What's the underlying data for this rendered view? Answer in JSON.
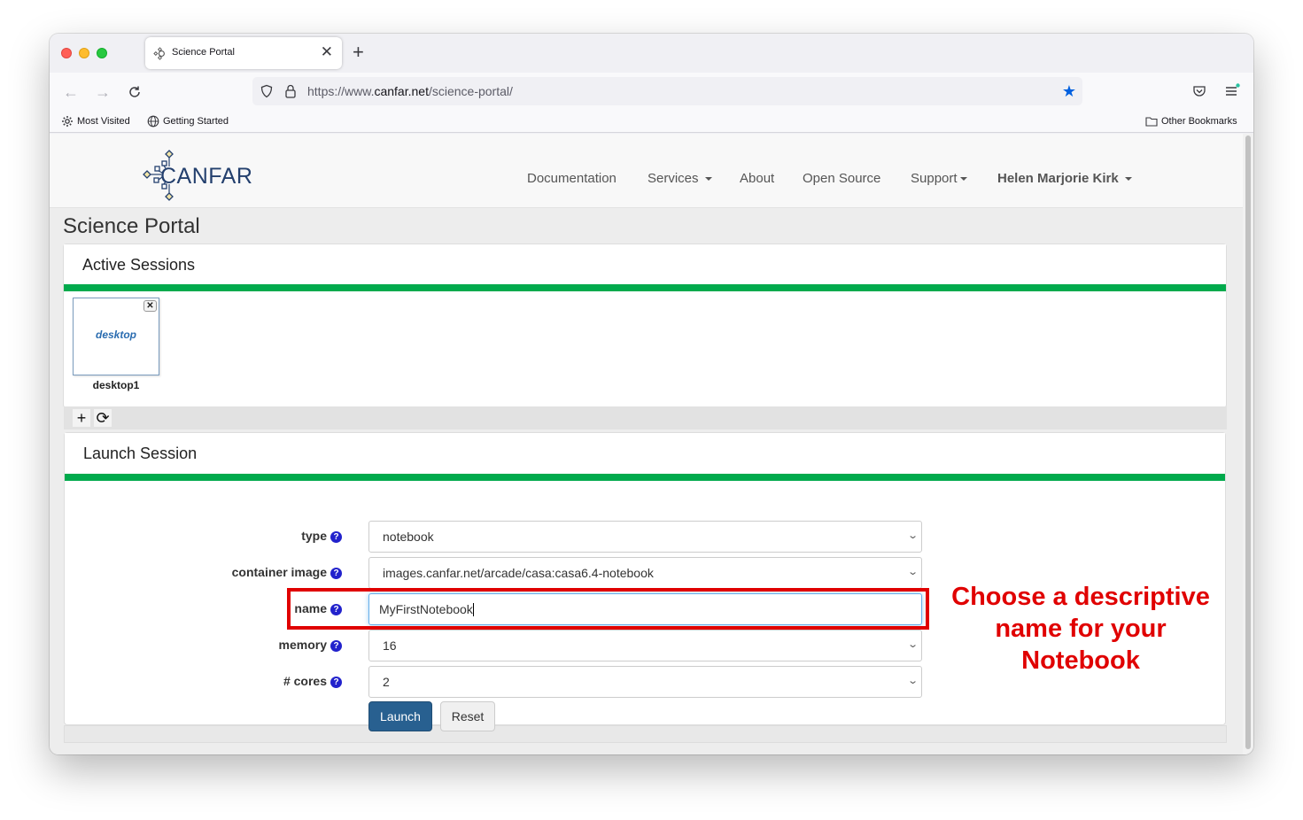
{
  "browser": {
    "tab_title": "Science Portal",
    "tab_close": "✕",
    "new_tab": "+",
    "url_host_prefix": "https://www.",
    "url_domain": "canfar.net",
    "url_path": "/science-portal/",
    "bookmarks": [
      {
        "label": "Most Visited",
        "icon": "gear-icon"
      },
      {
        "label": "Getting Started",
        "icon": "globe-icon"
      }
    ],
    "other_bookmarks": "Other Bookmarks"
  },
  "site": {
    "logo_text": "CANFAR",
    "nav": [
      {
        "label": "Documentation",
        "dropdown": false
      },
      {
        "label": "Services",
        "dropdown": true
      },
      {
        "label": "About",
        "dropdown": false
      },
      {
        "label": "Open Source",
        "dropdown": false
      },
      {
        "label": "Support",
        "dropdown": true
      }
    ],
    "user": "Helen Marjorie Kirk"
  },
  "page": {
    "title": "Science Portal",
    "active_sessions": {
      "heading": "Active Sessions",
      "sessions": [
        {
          "type": "desktop",
          "name": "desktop1"
        }
      ],
      "add_icon": "+",
      "refresh_icon": "⟳"
    },
    "launch": {
      "heading": "Launch Session",
      "fields": {
        "type": {
          "label": "type",
          "value": "notebook"
        },
        "image": {
          "label": "container image",
          "value": "images.canfar.net/arcade/casa:casa6.4-notebook"
        },
        "name": {
          "label": "name",
          "value": "MyFirstNotebook"
        },
        "memory": {
          "label": "memory",
          "value": "16"
        },
        "cores": {
          "label": "# cores",
          "value": "2"
        }
      },
      "help_glyph": "?",
      "launch_label": "Launch",
      "reset_label": "Reset"
    }
  },
  "annotation": {
    "lines": [
      "Choose a descriptive",
      "name for your",
      "Notebook"
    ],
    "color": "#e00000"
  },
  "colors": {
    "accent_green": "#00aa4c",
    "primary_button": "#286090",
    "logo": "#24406e"
  }
}
